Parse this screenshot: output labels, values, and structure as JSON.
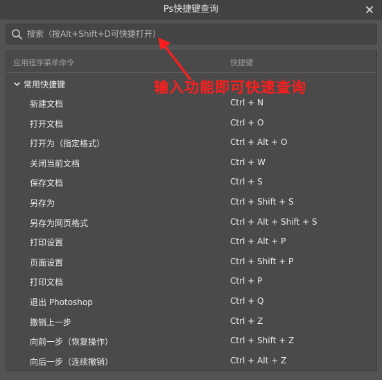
{
  "window": {
    "title": "Ps快捷键查询"
  },
  "search": {
    "placeholder": "搜索（按Alt+Shift+D可快捷打开）"
  },
  "columns": {
    "command": "应用程序菜单命令",
    "shortcut": "快捷键"
  },
  "group": {
    "label": "常用快捷键"
  },
  "annotation": {
    "text": "输入功能即可快速查询",
    "color": "#ff1d1d"
  },
  "rows": [
    {
      "name": "新建文档",
      "key": "Ctrl + N"
    },
    {
      "name": "打开文档",
      "key": "Ctrl + O"
    },
    {
      "name": "打开为（指定格式）",
      "key": "Ctrl + Alt + O"
    },
    {
      "name": "关闭当前文档",
      "key": "Ctrl + W"
    },
    {
      "name": "保存文档",
      "key": "Ctrl + S"
    },
    {
      "name": "另存为",
      "key": "Ctrl + Shift + S"
    },
    {
      "name": "另存为网页格式",
      "key": "Ctrl + Alt + Shift + S"
    },
    {
      "name": "打印设置",
      "key": "Ctrl + Alt + P"
    },
    {
      "name": "页面设置",
      "key": "Ctrl + Shift + P"
    },
    {
      "name": "打印文档",
      "key": "Ctrl + P"
    },
    {
      "name": "退出 Photoshop",
      "key": "Ctrl + Q"
    },
    {
      "name": "撤销上一步",
      "key": "Ctrl + Z"
    },
    {
      "name": "向前一步（恢复操作）",
      "key": "Ctrl + Shift + Z"
    },
    {
      "name": "向后一步（连续撤销）",
      "key": "Ctrl + Alt + Z"
    }
  ]
}
